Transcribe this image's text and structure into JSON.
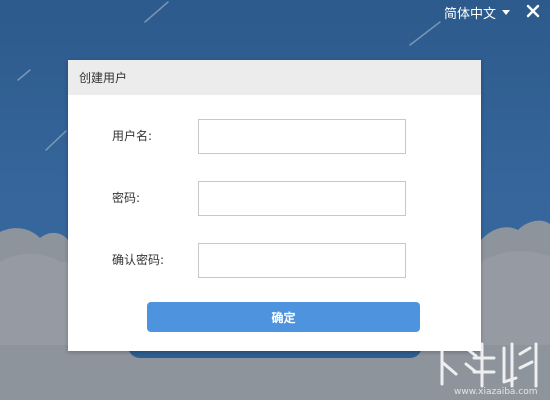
{
  "header": {
    "language": "简体中文"
  },
  "dialog": {
    "title": "创建用户",
    "fields": {
      "username": {
        "label": "用户名:",
        "value": "",
        "placeholder": ""
      },
      "password": {
        "label": "密码:",
        "value": "",
        "placeholder": ""
      },
      "confirm_password": {
        "label": "确认密码:",
        "value": "",
        "placeholder": ""
      }
    },
    "confirm_label": "确定"
  },
  "colors": {
    "background": "#2d5a8c",
    "cloud": "#8e949c",
    "dialog_header": "#ececec",
    "button": "#4e93de"
  },
  "icons": {
    "language_dropdown": "chevron-down-icon",
    "close": "close-icon",
    "watermark": "site-logo-watermark"
  }
}
